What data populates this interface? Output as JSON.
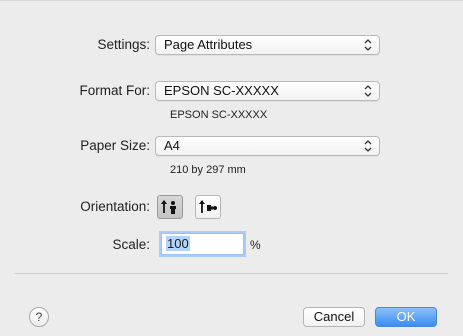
{
  "settings": {
    "label": "Settings:",
    "value": "Page Attributes"
  },
  "format_for": {
    "label": "Format For:",
    "value": "EPSON SC-XXXXX",
    "detail": "EPSON SC-XXXXX"
  },
  "paper_size": {
    "label": "Paper Size:",
    "value": "A4",
    "detail": "210 by 297 mm"
  },
  "orientation": {
    "label": "Orientation:",
    "options": [
      "portrait",
      "landscape"
    ],
    "selected": "portrait"
  },
  "scale": {
    "label": "Scale:",
    "value": "100",
    "unit": "%"
  },
  "footer": {
    "help": "?",
    "cancel_label": "Cancel",
    "ok_label": "OK"
  },
  "colors": {
    "accent": "#3a8ef2",
    "focus_ring": "#a9cdf6",
    "background": "#ececec"
  }
}
